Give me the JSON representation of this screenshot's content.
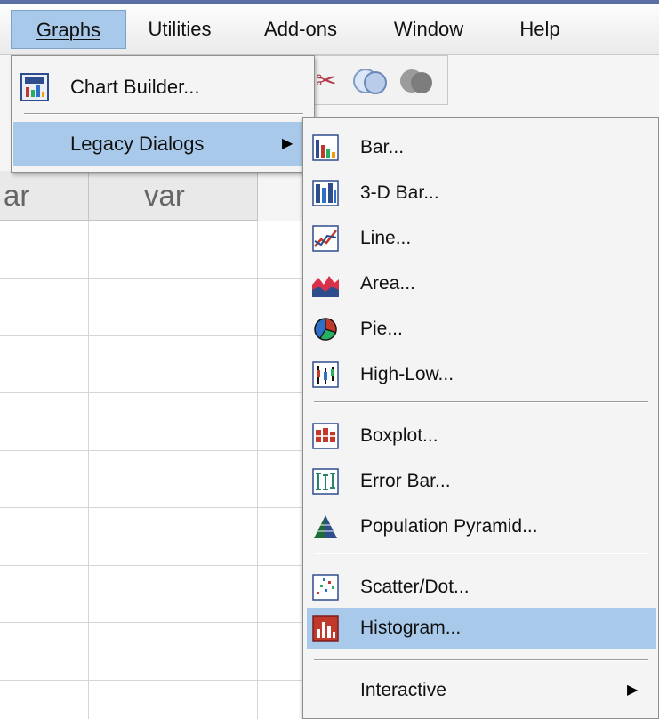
{
  "menubar": {
    "items": [
      {
        "label": "Graphs",
        "active": true
      },
      {
        "label": "Utilities"
      },
      {
        "label": "Add-ons"
      },
      {
        "label": "Window"
      },
      {
        "label": "Help"
      }
    ]
  },
  "grid": {
    "headers": [
      "ar",
      "var"
    ]
  },
  "graphs_menu": {
    "chart_builder": "Chart Builder...",
    "legacy_dialogs": "Legacy Dialogs"
  },
  "legacy_menu": {
    "items": [
      {
        "label": "Bar...",
        "icon": "bar-chart-icon"
      },
      {
        "label": "3-D Bar...",
        "icon": "3d-bar-chart-icon"
      },
      {
        "label": "Line...",
        "icon": "line-chart-icon"
      },
      {
        "label": "Area...",
        "icon": "area-chart-icon"
      },
      {
        "label": "Pie...",
        "icon": "pie-chart-icon"
      },
      {
        "label": "High-Low...",
        "icon": "high-low-chart-icon"
      },
      {
        "label": "Boxplot...",
        "icon": "boxplot-icon"
      },
      {
        "label": "Error Bar...",
        "icon": "error-bar-icon"
      },
      {
        "label": "Population Pyramid...",
        "icon": "population-pyramid-icon"
      },
      {
        "label": "Scatter/Dot...",
        "icon": "scatter-dot-icon"
      },
      {
        "label": "Histogram...",
        "icon": "histogram-icon",
        "selected": true
      },
      {
        "label": "Interactive"
      }
    ]
  },
  "colors": {
    "highlight": "#a9c9ea",
    "menu_bg": "#f4f4f4"
  }
}
